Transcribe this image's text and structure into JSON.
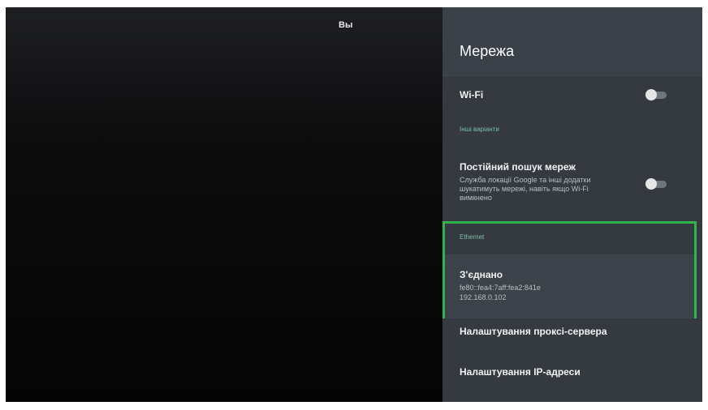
{
  "overlay": {
    "label": "Вы"
  },
  "panel": {
    "title": "Мережа",
    "wifi": {
      "label": "Wi-Fi",
      "toggle_state": "off"
    },
    "other_options_label": "Інші варіанти",
    "always_scan": {
      "label": "Постійний пошук мереж",
      "description": "Служба локації Google та інші додатки шукатимуть мережі, навіть якщо Wi-Fi вимкнено",
      "toggle_state": "off"
    },
    "ethernet": {
      "section_label": "Ethernet",
      "status": "З'єднано",
      "ipv6": "fe80::fea4:7aff:fea2:841e",
      "ipv4": "192.168.0.102"
    },
    "proxy_settings_label": "Налаштування проксі-сервера",
    "ip_settings_label": "Налаштування IP-адреси"
  },
  "colors": {
    "panel_bg": "#343a40",
    "highlight_border": "#2fb34a",
    "section_label": "#7fbfa6"
  }
}
